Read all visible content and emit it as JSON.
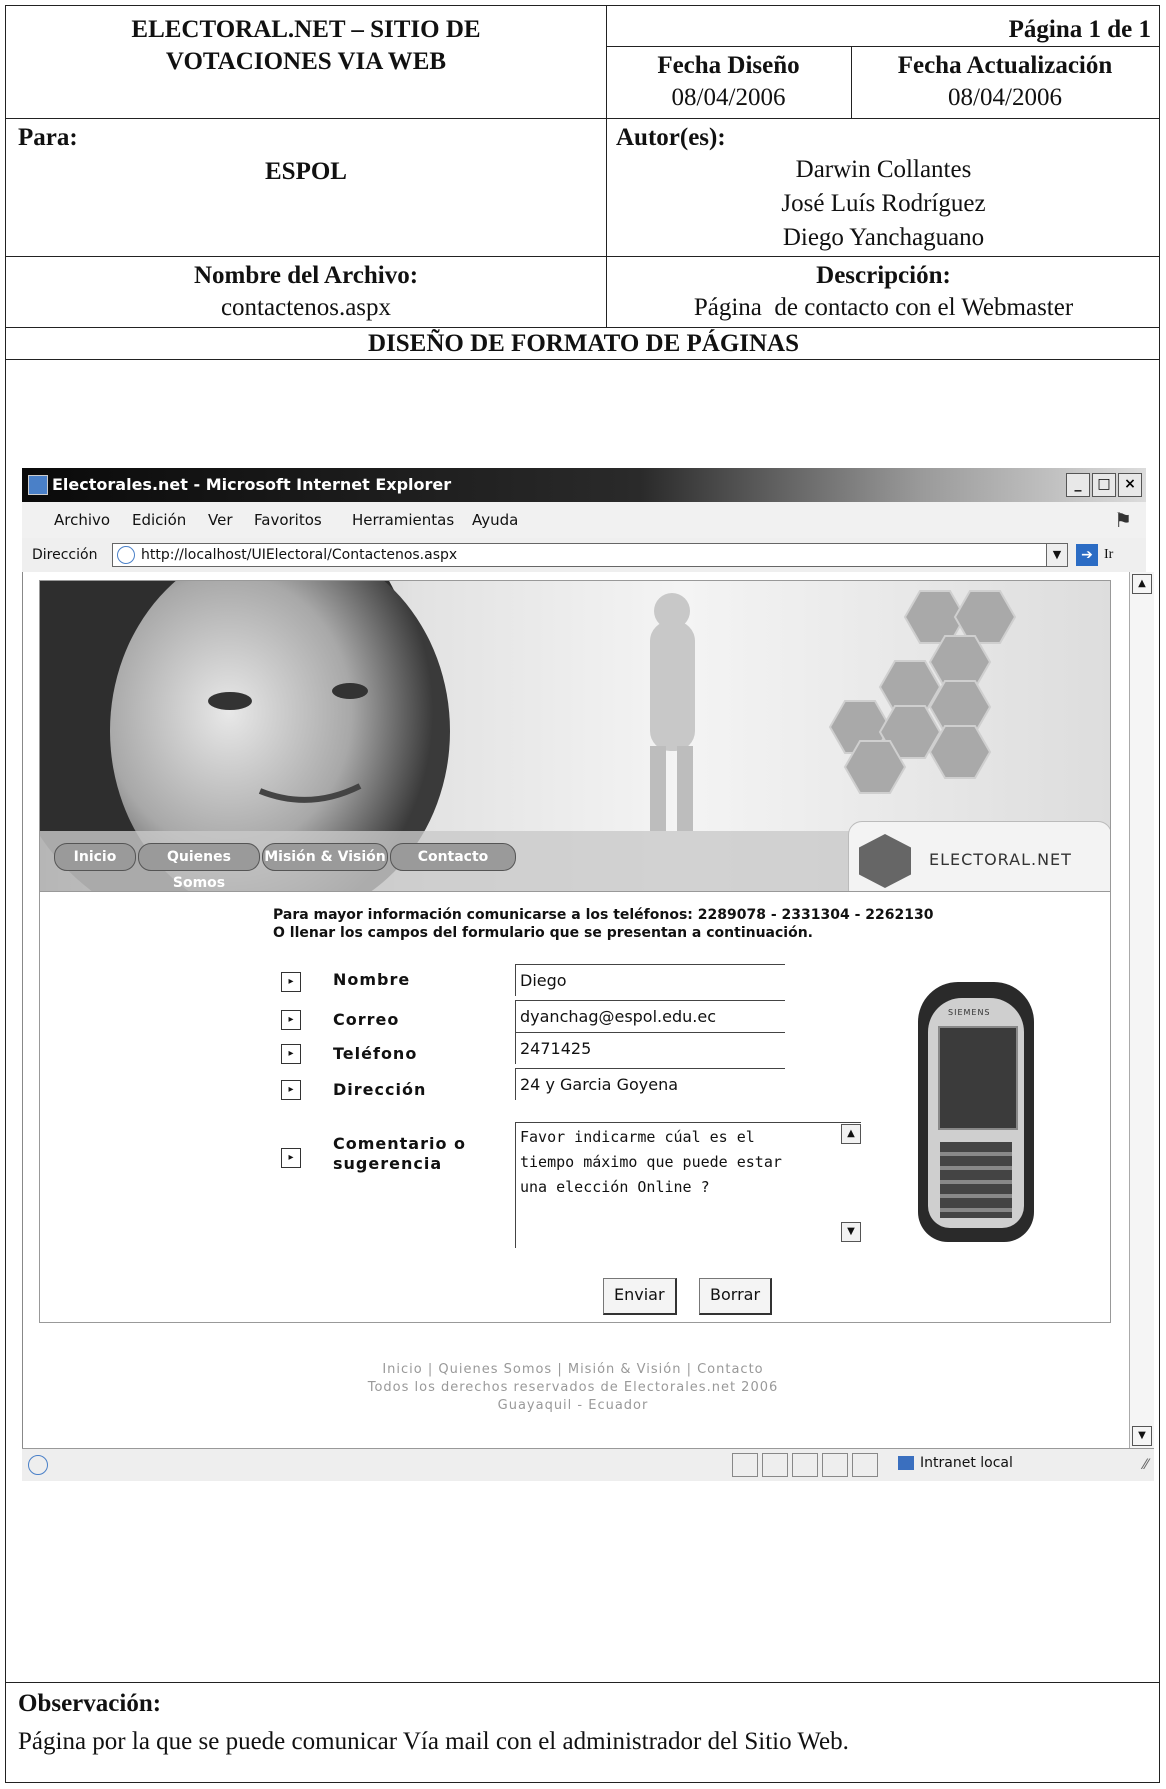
{
  "header": {
    "title_line1": "ELECTORAL.NET – SITIO DE",
    "title_line2": "VOTACIONES VIA WEB",
    "page": "Página 1 de 1",
    "design_date_label": "Fecha Diseño",
    "design_date": "08/04/2006",
    "update_date_label": "Fecha Actualización",
    "update_date": "08/04/2006",
    "for_label": "Para:",
    "for_value": "ESPOL",
    "authors_label": "Autor(es):",
    "authors": [
      "Darwin Collantes",
      "José Luís Rodríguez",
      "Diego Yanchaguano"
    ],
    "filename_label": "Nombre del Archivo:",
    "filename": "contactenos.aspx",
    "description_label": "Descripción:",
    "description": "Página  de contacto con el Webmaster",
    "section_title": "DISEÑO DE FORMATO DE PÁGINAS"
  },
  "browser": {
    "title": "Electorales.net - Microsoft Internet Explorer",
    "menu": [
      "Archivo",
      "Edición",
      "Ver",
      "Favoritos",
      "Herramientas",
      "Ayuda"
    ],
    "address_label": "Dirección",
    "address": "http://localhost/UIElectoral/Contactenos.aspx",
    "go_label": "Ir",
    "status_zone": "Intranet local"
  },
  "site": {
    "nav": [
      "Inicio",
      "Quienes Somos",
      "Misión & Visión",
      "Contacto"
    ],
    "logo_text": "ELECTORAL.NET",
    "info_line1": "Para mayor información comunicarse a los teléfonos: 2289078 - 2331304 - 2262130",
    "info_line2": "O llenar los campos del formulario que se presentan a continuación.",
    "fields": {
      "name_label": "Nombre",
      "name_value": "Diego",
      "email_label": "Correo",
      "email_value": "dyanchag@espol.edu.ec",
      "phone_label": "Teléfono",
      "phone_value": "2471425",
      "address_label": "Dirección",
      "address_value": "24 y Garcia Goyena",
      "comment_label_1": "Comentario o",
      "comment_label_2": "sugerencia",
      "comment_value": "Favor indicarme cúal es el\ntiempo máximo que puede estar\nuna elección Online ?"
    },
    "send_button": "Enviar",
    "clear_button": "Borrar",
    "phone_brand": "SIEMENS",
    "footer_links": "Inicio | Quienes Somos | Misión & Visión | Contacto",
    "footer_rights": "Todos los derechos reservados de Electorales.net 2006",
    "footer_city": "Guayaquil - Ecuador"
  },
  "observation": {
    "label": "Observación:",
    "text": "Página por la que se puede comunicar Vía mail con el administrador del Sitio Web."
  }
}
